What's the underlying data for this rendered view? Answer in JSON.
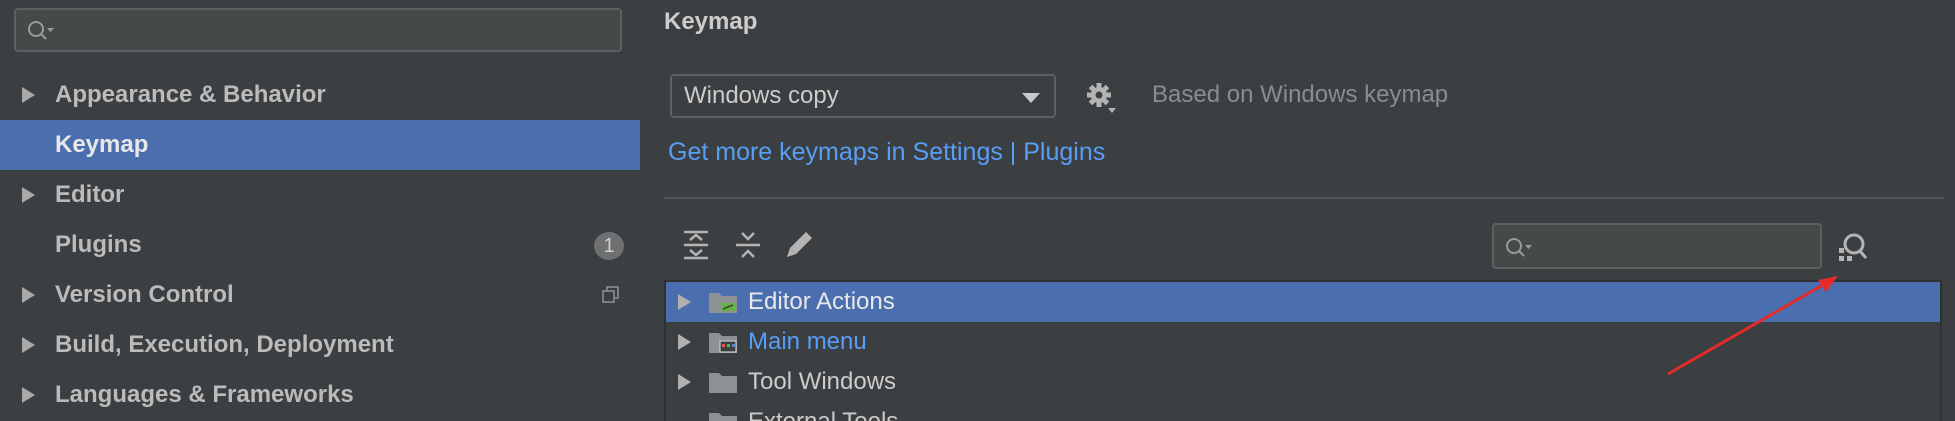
{
  "sidebar": {
    "search": {
      "placeholder": "",
      "value": "",
      "icon": "search-icon"
    },
    "items": [
      {
        "label": "Appearance & Behavior",
        "expandable": true,
        "selected": false
      },
      {
        "label": "Keymap",
        "expandable": false,
        "selected": true
      },
      {
        "label": "Editor",
        "expandable": true,
        "selected": false
      },
      {
        "label": "Plugins",
        "expandable": false,
        "selected": false,
        "badge": "1"
      },
      {
        "label": "Version Control",
        "expandable": true,
        "selected": false,
        "icon": "copy-icon"
      },
      {
        "label": "Build, Execution, Deployment",
        "expandable": true,
        "selected": false
      },
      {
        "label": "Languages & Frameworks",
        "expandable": true,
        "selected": false
      }
    ]
  },
  "main": {
    "title": "Keymap",
    "scheme": {
      "selected": "Windows copy",
      "icon": "chevron-down-icon"
    },
    "settings_icon": "gear-icon",
    "based_on": "Based on Windows keymap",
    "link_text": "Get more keymaps in Settings | Plugins",
    "toolbar": {
      "expand_all_icon": "expand-all-icon",
      "collapse_all_icon": "collapse-all-icon",
      "edit_icon": "pencil-icon",
      "find_shortcut_icon": "find-by-shortcut-icon"
    },
    "filter": {
      "placeholder": "",
      "value": ""
    },
    "tree": [
      {
        "label": "Editor Actions",
        "selected": true,
        "link": false
      },
      {
        "label": "Main menu",
        "selected": false,
        "link": true
      },
      {
        "label": "Tool Windows",
        "selected": false,
        "link": false
      },
      {
        "label": "External Tools",
        "selected": false,
        "link": false
      }
    ]
  },
  "colors": {
    "background": "#3c3f41",
    "selection": "#4b6eaf",
    "link": "#589df6",
    "annotation_arrow": "#e52a2a"
  }
}
